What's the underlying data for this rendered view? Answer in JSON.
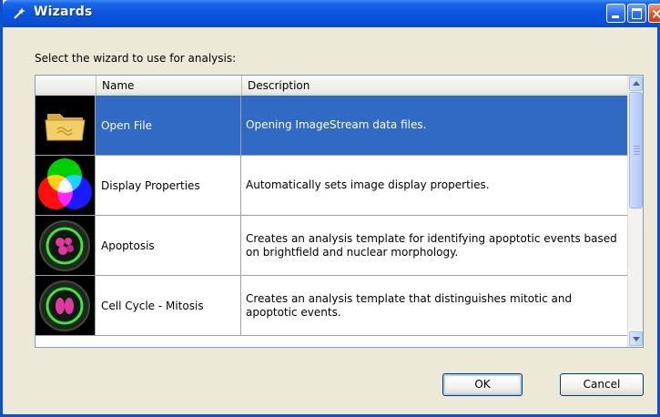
{
  "window": {
    "title": "Wizards",
    "title_icon": "wand-icon",
    "controls": {
      "minimize": "minimize-icon",
      "maximize": "maximize-icon",
      "close": "×"
    }
  },
  "prompt": "Select the wizard to use for analysis:",
  "list": {
    "columns": [
      "",
      "Name",
      "Description"
    ],
    "selected_index": 0,
    "rows": [
      {
        "icon": "folder-icon",
        "name": "Open File",
        "description": "Opening ImageStream data files."
      },
      {
        "icon": "color-wheel-icon",
        "name": "Display Properties",
        "description": "Automatically sets image display properties."
      },
      {
        "icon": "apoptosis-cell-icon",
        "name": "Apoptosis",
        "description": "Creates an analysis template for identifying apoptotic events based on brightfield and nuclear morphology."
      },
      {
        "icon": "mitosis-cell-icon",
        "name": "Cell Cycle - Mitosis",
        "description": "Creates an analysis template that distinguishes mitotic and apoptotic events."
      }
    ]
  },
  "buttons": {
    "ok": "OK",
    "cancel": "Cancel"
  },
  "colors": {
    "titlebar": "#0a50d0",
    "selection": "#316ac5",
    "face": "#ece9d8"
  }
}
